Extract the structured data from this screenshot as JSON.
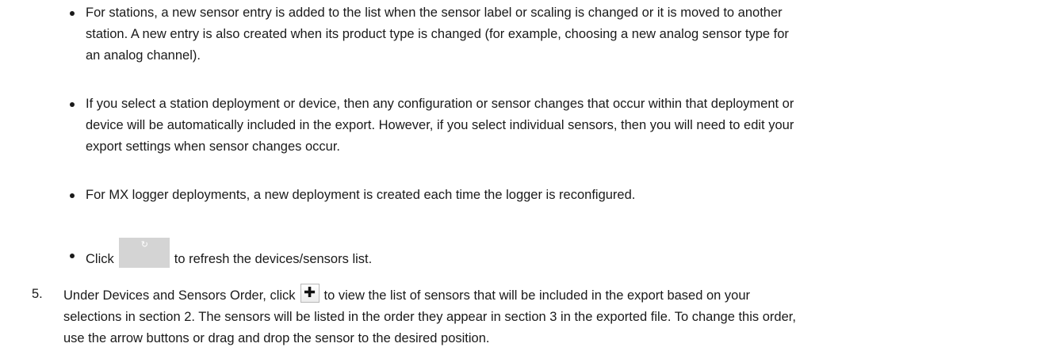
{
  "bullets": [
    {
      "line1": "For stations, a new sensor entry is added to the list when the sensor label or scaling is changed or it is moved to another",
      "line2": "station. A new entry is also created when its product type is changed (for example, choosing a new analog sensor type for",
      "line3": "an analog channel)."
    },
    {
      "line1": "If you select a station deployment or device, then any configuration or sensor changes that occur within that deployment or",
      "line2": "device will be automatically included in the export. However, if you select individual sensors, then you will need to edit your",
      "line3": "export settings when sensor changes occur."
    },
    {
      "line1": "For MX logger deployments, a new deployment is created each time the logger is reconfigured."
    },
    {
      "before": "Click",
      "after": "to refresh the devices/sensors list.",
      "icon": "refresh-icon"
    }
  ],
  "step5": {
    "number": "5.",
    "before": "Under Devices and Sensors Order, click",
    "icon": "plus-icon",
    "line1_after": "to view the list of sensors that will be included in the export based on your",
    "line2": "selections in section 2. The sensors will be listed in the order they appear in section 3 in the exported file. To change this order,",
    "line3": "use the arrow buttons or drag and drop the sensor to the desired position."
  },
  "icons": {
    "refresh_glyph": "↻",
    "plus_glyph": "✚"
  },
  "colors": {
    "text": "#1a1a1a",
    "refresh_button_bg": "#d4d4d4"
  }
}
